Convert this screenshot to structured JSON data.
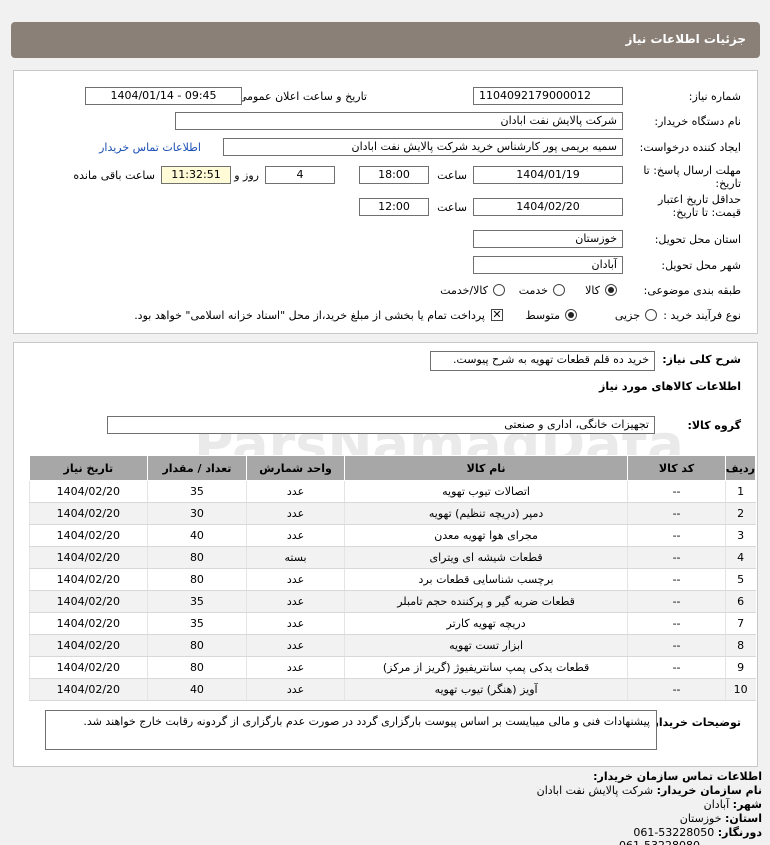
{
  "header": {
    "title": "جزئیات اطلاعات نیاز"
  },
  "form": {
    "need_number_label": "شماره نیاز:",
    "need_number": "1104092179000012",
    "announce_label": "تاریخ و ساعت اعلان عمومی:",
    "announce_value": "1404/01/14 - 09:45",
    "buyer_org_label": "نام دستگاه خریدار:",
    "buyer_org": "شرکت پالایش نفت ابادان",
    "creator_label": "ایجاد کننده درخواست:",
    "creator": "سمیه بریمی پور کارشناس خرید شرکت پالایش نفت ابادان",
    "contact_link": "اطلاعات تماس خریدار",
    "deadline_label": "مهلت ارسال پاسخ: تا تاریخ:",
    "deadline_date": "1404/01/19",
    "hour_label": "ساعت",
    "deadline_time": "18:00",
    "days_value": "4",
    "days_label": "روز و",
    "remaining_time": "11:32:51",
    "remaining_label": "ساعت باقی مانده",
    "validity_label": "حداقل تاریخ اعتبار قیمت: تا تاریخ:",
    "validity_date": "1404/02/20",
    "validity_hour_label": "ساعت",
    "validity_time": "12:00",
    "province_label": "استان محل تحویل:",
    "province": "خوزستان",
    "city_label": "شهر محل تحویل:",
    "city": "آبادان",
    "category_label": "طبقه بندی موضوعی:",
    "cat_goods": "کالا",
    "cat_service": "خدمت",
    "cat_goods_service": "کالا/خدمت",
    "process_label": "نوع فرآیند خرید :",
    "proc_partial": "جزیی",
    "proc_medium": "متوسط",
    "payment_note": "پرداخت تمام یا بخشی از مبلغ خرید،از محل \"اسناد خزانه اسلامی\" خواهد بود."
  },
  "section2": {
    "summary_label": "شرح کلی نیاز:",
    "summary": "خرید ده قلم قطعات تهویه به شرح پیوست.",
    "items_heading": "اطلاعات کالاهای مورد نیاز",
    "group_label": "گروه کالا:",
    "group_value": "تجهیزات خانگی، اداری و صنعتی",
    "columns": [
      "ردیف",
      "کد کالا",
      "نام کالا",
      "واحد شمارش",
      "تعداد / مقدار",
      "تاریخ نیاز"
    ],
    "rows": [
      [
        "1",
        "--",
        "اتصالات تیوب تهویه",
        "عدد",
        "35",
        "1404/02/20"
      ],
      [
        "2",
        "--",
        "دمپر (دریچه تنظیم) تهویه",
        "عدد",
        "30",
        "1404/02/20"
      ],
      [
        "3",
        "--",
        "مجرای هوا تهویه معدن",
        "عدد",
        "40",
        "1404/02/20"
      ],
      [
        "4",
        "--",
        "قطعات شیشه ای ویترای",
        "بسته",
        "80",
        "1404/02/20"
      ],
      [
        "5",
        "--",
        "برچسب شناسایی قطعات برد",
        "عدد",
        "80",
        "1404/02/20"
      ],
      [
        "6",
        "--",
        "قطعات ضربه گیر و پرکننده حجم تامبلر",
        "عدد",
        "35",
        "1404/02/20"
      ],
      [
        "7",
        "--",
        "دریچه تهویه کارتر",
        "عدد",
        "35",
        "1404/02/20"
      ],
      [
        "8",
        "--",
        "ابزار تست تهویه",
        "عدد",
        "80",
        "1404/02/20"
      ],
      [
        "9",
        "--",
        "قطعات یدکی پمپ سانتریفیوژ (گریز از مرکز)",
        "عدد",
        "80",
        "1404/02/20"
      ],
      [
        "10",
        "--",
        "آویز (هنگر) تیوب تهویه",
        "عدد",
        "40",
        "1404/02/20"
      ]
    ],
    "notes_label": "توضیحات خریدار:",
    "notes": "پیشنهادات فنی و مالی میبایست بر اساس پیوست بارگزاری گردد در صورت عدم بارگزاری از گردونه رقابت خارج خواهند شد."
  },
  "contact": {
    "heading": "اطلاعات تماس سازمان خریدار:",
    "org_label": "نام سازمان خریدار:",
    "org": "شرکت پالایش نفت ابادان",
    "city_label": "شهر:",
    "city": "آبادان",
    "province_label": "استان:",
    "province": "خوزستان",
    "phone_label": "دورنگار:",
    "phone": "061-53228050",
    "fax": "061-53228080"
  },
  "watermark": {
    "brand": "ParsNamadData",
    "tagline": "مرکز اطلاعات پارس نماد داده ها",
    "tagline2": "پایگاه اطلاع رسانی مناقصه مزایده",
    "phone": "۰۲۱-۸۸۳۴۹۶۷۰"
  },
  "colors": {
    "titlebar": "#8a8078",
    "table_header": "#a7a7a7",
    "link": "#1a4fb5",
    "remaining_bg": "#fffbd6"
  }
}
